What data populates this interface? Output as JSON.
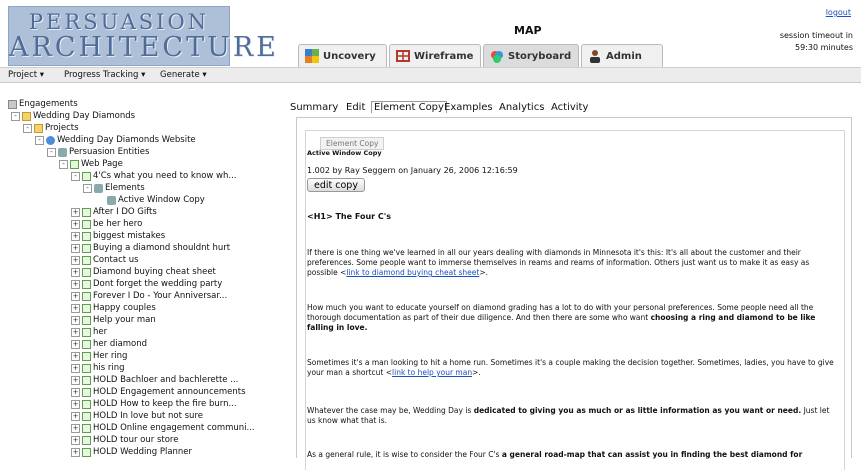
{
  "logo": {
    "line1": "PERSUASION",
    "line2": "ARCHITECTURE"
  },
  "app_title": "MAP",
  "logout_label": "logout",
  "session": {
    "line1": "session timeout in",
    "line2": "59:30 minutes"
  },
  "top_tabs": [
    {
      "label": "Uncovery",
      "icon": "puzzle-icon"
    },
    {
      "label": "Wireframe",
      "icon": "wireframe-icon"
    },
    {
      "label": "Storyboard",
      "icon": "storyboard-icon",
      "active": true
    },
    {
      "label": "Admin",
      "icon": "admin-person-icon"
    }
  ],
  "menubar": [
    "Project ▾",
    "Progress Tracking ▾",
    "Generate ▾"
  ],
  "tree": [
    {
      "label": "Engagements",
      "icon": "drive"
    },
    {
      "label": "Wedding Day Diamonds",
      "icon": "folder"
    },
    {
      "label": "Projects",
      "icon": "folder"
    },
    {
      "label": "Wedding Day Diamonds Website",
      "icon": "globe"
    },
    {
      "label": "Persuasion Entities",
      "icon": "ent"
    },
    {
      "label": "Web Page",
      "icon": "doc"
    },
    {
      "label": "4'Cs what you need to know wh...",
      "icon": "doc"
    },
    {
      "label": "Elements",
      "icon": "ent"
    },
    {
      "label": "Active Window Copy",
      "icon": "ent"
    },
    {
      "label": "After I DO Gifts",
      "icon": "doc"
    },
    {
      "label": "be her hero",
      "icon": "doc"
    },
    {
      "label": "biggest mistakes",
      "icon": "doc"
    },
    {
      "label": "Buying a diamond shouldnt hurt",
      "icon": "doc"
    },
    {
      "label": "Contact us",
      "icon": "doc"
    },
    {
      "label": "Diamond buying cheat sheet",
      "icon": "doc"
    },
    {
      "label": "Dont forget the wedding party",
      "icon": "doc"
    },
    {
      "label": "Forever I Do - Your Anniversar...",
      "icon": "doc"
    },
    {
      "label": "Happy couples",
      "icon": "doc"
    },
    {
      "label": "Help your man",
      "icon": "doc"
    },
    {
      "label": "her",
      "icon": "doc"
    },
    {
      "label": "her diamond",
      "icon": "doc"
    },
    {
      "label": "Her ring",
      "icon": "doc"
    },
    {
      "label": "his ring",
      "icon": "doc"
    },
    {
      "label": "HOLD Bachloer and bachlerette ...",
      "icon": "doc"
    },
    {
      "label": "HOLD Engagement announcements",
      "icon": "doc"
    },
    {
      "label": "HOLD How to keep the fire burn...",
      "icon": "doc"
    },
    {
      "label": "HOLD In love but not sure",
      "icon": "doc"
    },
    {
      "label": "HOLD Online engagement communi...",
      "icon": "doc"
    },
    {
      "label": "HOLD tour our store",
      "icon": "doc"
    },
    {
      "label": "HOLD Wedding Planner",
      "icon": "doc"
    }
  ],
  "content_tabs": [
    "Summary",
    "Edit",
    "Element Copy",
    "Examples",
    "Analytics",
    "Activity"
  ],
  "fieldset_legend": "Element Copy",
  "copy_heading": "Active Window Copy",
  "version_line": "1.002 by Ray Seggern on January 26, 2006 12:16:59",
  "edit_button": "edit copy",
  "h1_line": "<H1> The Four C's",
  "p1": {
    "text": "If there is one thing we've learned in all our years dealing with diamonds in Minnesota it's this:  It's all about the customer and their preferences.  Some people want to immerse themselves in reams and reams of information.  Others just want us to make it as easy as possible <",
    "link": "link to diamond buying cheat sheet",
    "tail": ">."
  },
  "p2": {
    "text": "How much you want to educate yourself on diamond grading has a lot to do with your personal preferences.  Some people need all the thorough documentation as part of their due diligence. And then there are some who want ",
    "bold": "choosing a ring and diamond to be like falling in love."
  },
  "p3": {
    "text": "Sometimes it's a man looking to hit a home run.  Sometimes it's a couple making the decision together.  Sometimes, ladies, you have to give your man a shortcut <",
    "link": "link to help your man",
    "tail": ">."
  },
  "p4": {
    "text": "Whatever the case may be, Wedding Day is ",
    "bold": "dedicated to giving you as much or as little information as you want or need.",
    "tail": "  Just let us know what that is."
  },
  "p5": {
    "text": "As a general rule, it is wise to consider the Four C's ",
    "bold": "a general road-map that can assist you in finding the best diamond for"
  }
}
